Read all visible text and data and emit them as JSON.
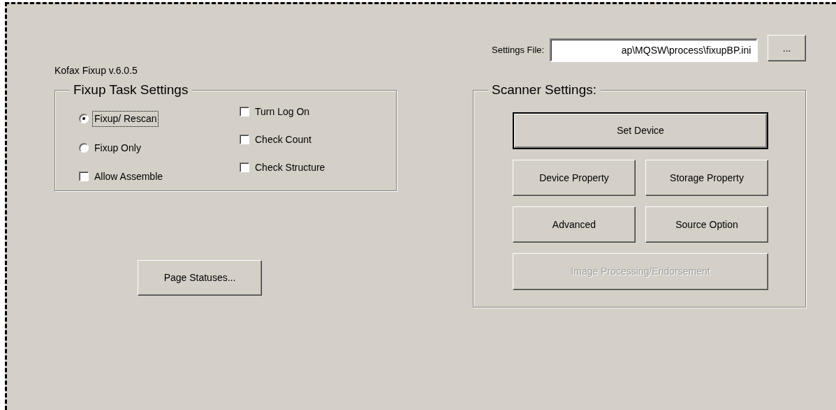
{
  "app_version": "Kofax Fixup v.6.0.5",
  "task_settings": {
    "title": "Fixup Task Settings",
    "left_options": [
      {
        "kind": "radio",
        "label": "Fixup/ Rescan",
        "selected": true,
        "focused": true
      },
      {
        "kind": "radio",
        "label": "Fixup Only",
        "selected": false,
        "focused": false
      },
      {
        "kind": "checkbox",
        "label": "Allow Assemble",
        "checked": false,
        "focused": false
      }
    ],
    "right_options": [
      {
        "kind": "checkbox",
        "label": "Turn Log On",
        "checked": false,
        "focused": false
      },
      {
        "kind": "checkbox",
        "label": "Check Count",
        "checked": false,
        "focused": false
      },
      {
        "kind": "checkbox",
        "label": "Check Structure",
        "checked": false,
        "focused": false
      }
    ]
  },
  "page_statuses_button": {
    "label": "Page Statuses..."
  },
  "settings_file": {
    "label": "Settings File:",
    "value": "ap\\MQSW\\process\\fixupBP.ini",
    "browse_label": "..."
  },
  "scanner_settings": {
    "title": "Scanner Settings:",
    "buttons": [
      {
        "kind": "wide",
        "label": "Set Device",
        "default": true,
        "disabled": false
      },
      {
        "kind": "half",
        "label": "Device Property",
        "default": false,
        "disabled": false
      },
      {
        "kind": "half",
        "label": "Storage Property",
        "default": false,
        "disabled": false
      },
      {
        "kind": "half",
        "label": "Advanced",
        "default": false,
        "disabled": false
      },
      {
        "kind": "half",
        "label": "Source Option",
        "default": false,
        "disabled": false
      },
      {
        "kind": "wide",
        "label": "Image Processing/Endorsement",
        "default": false,
        "disabled": true
      }
    ]
  }
}
